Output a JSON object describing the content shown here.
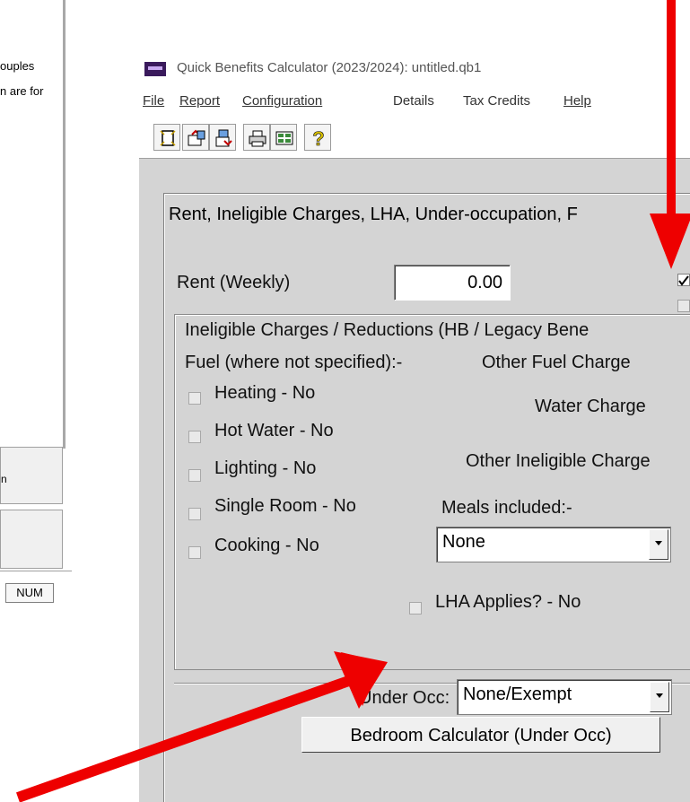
{
  "background_window": {
    "text_line_1": "ouples",
    "text_line_2": "n are for",
    "button_1_label": "n",
    "status_num": "NUM"
  },
  "window": {
    "title": "Quick Benefits Calculator (2023/2024): untitled.qb1"
  },
  "menu": {
    "file": "File",
    "report": "Report",
    "configuration": "Configuration",
    "details": "Details",
    "tax_credits": "Tax Credits",
    "help": "Help"
  },
  "toolbar": {
    "icons": [
      "new-document-icon",
      "open-icon",
      "save-icon",
      "print-icon",
      "calculator-icon",
      "help-icon"
    ],
    "help_glyph": "?"
  },
  "form": {
    "group_title": "Rent, Ineligible Charges, LHA, Under-occupation, F",
    "rent_label": "Rent (Weekly)",
    "rent_value": "0.00",
    "ineligible_title": "Ineligible Charges / Reductions (HB / Legacy Bene",
    "fuel_label": "Fuel (where not specified):-",
    "other_fuel_label": "Other Fuel Charge",
    "water_label": "Water Charge",
    "other_ineligible_label": "Other Ineligible Charge",
    "meals_label": "Meals included:-",
    "meals_value": "None",
    "checkboxes": {
      "heating": "Heating - No",
      "hot_water": "Hot Water - No",
      "lighting": "Lighting - No",
      "single_room": "Single Room - No",
      "cooking": "Cooking - No"
    },
    "lha_label": "LHA Applies? - No",
    "under_occ_label": "Under Occ:",
    "under_occ_value": "None/Exempt",
    "bedroom_button": "Bedroom Calculator (Under Occ)"
  },
  "colors": {
    "panel_bg": "#d4d4d4",
    "annotation_arrow": "#ee0000"
  }
}
